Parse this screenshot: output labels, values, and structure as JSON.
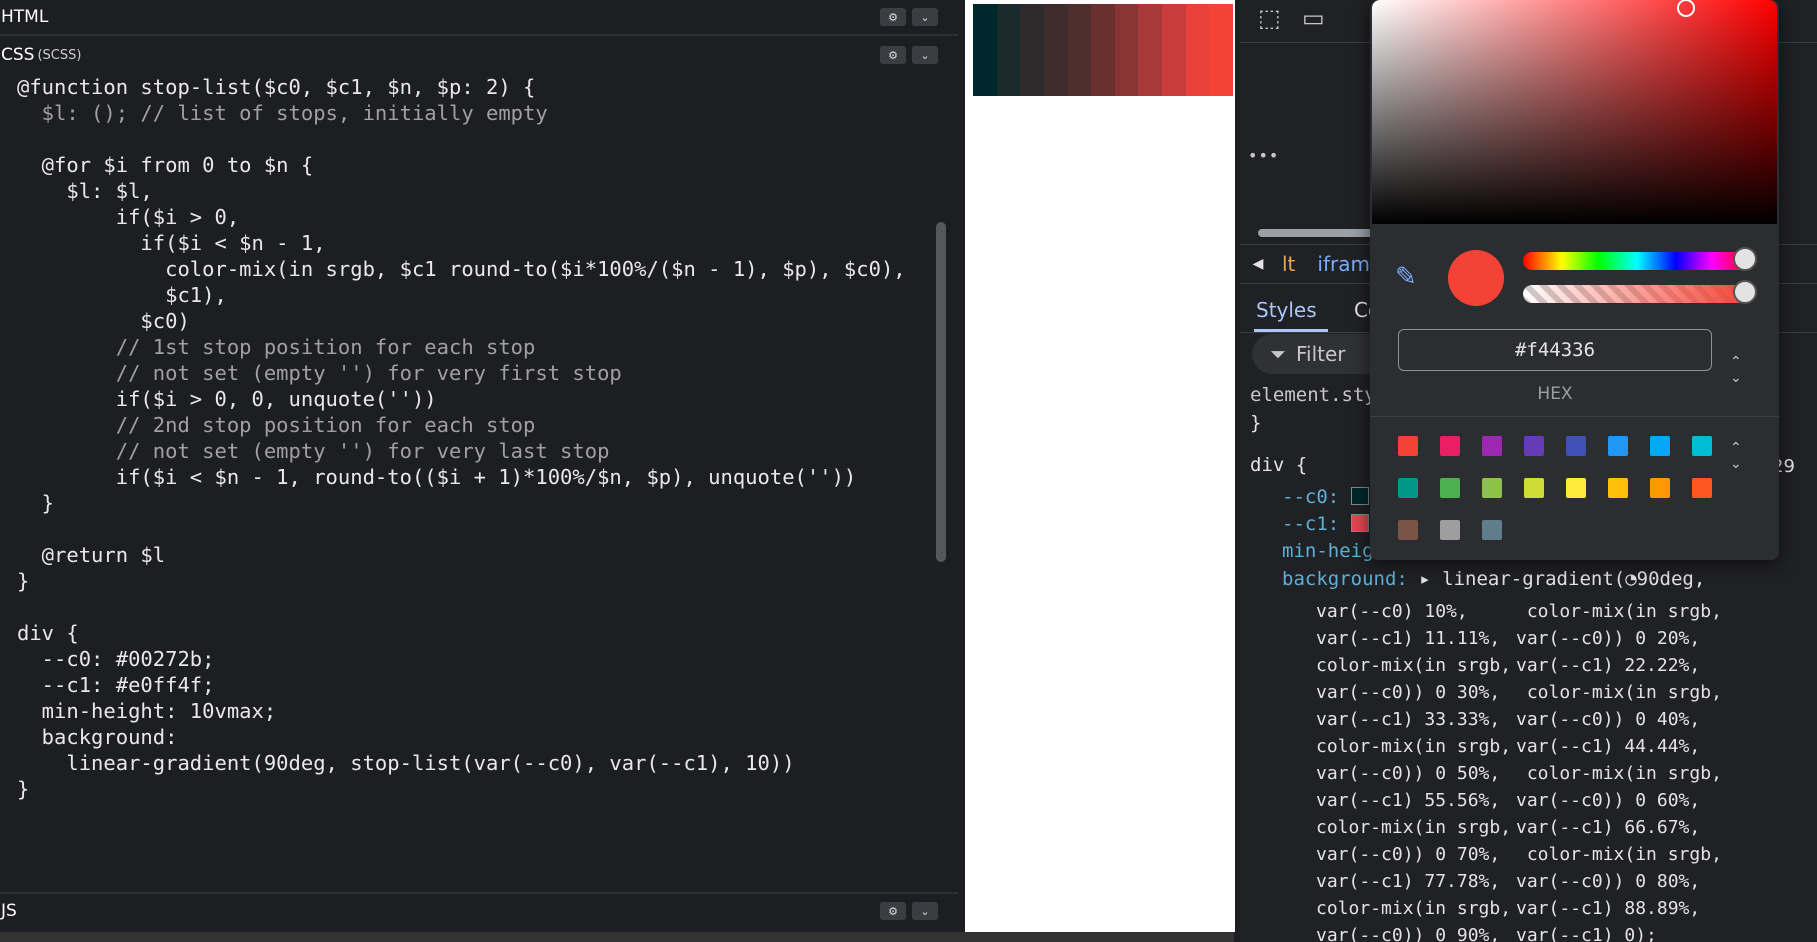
{
  "editor": {
    "html_title": "HTML",
    "css_title": "CSS",
    "css_sub": "(SCSS)",
    "js_title": "JS",
    "settings_icon": "gear-icon",
    "collapse_icon": "chevron-down-icon",
    "code_lines": [
      "@function stop-list($c0, $c1, $n, $p: 2) {",
      "  $l: (); // list of stops, initially empty",
      "",
      "  @for $i from 0 to $n {",
      "    $l: $l,",
      "        if($i > 0,",
      "          if($i < $n - 1,",
      "            color-mix(in srgb, $c1 round-to($i*100%/($n - 1), $p), $c0),",
      "            $c1),",
      "          $c0)",
      "        // 1st stop position for each stop",
      "        // not set (empty '') for very first stop",
      "        if($i > 0, 0, unquote(''))",
      "        // 2nd stop position for each stop",
      "        // not set (empty '') for very last stop",
      "        if($i < $n - 1, round-to(($i + 1)*100%/$n, $p), unquote(''))",
      "  }",
      "",
      "  @return $l",
      "}",
      "",
      "div {",
      "  --c0: #00272b;",
      "  --c1: #e0ff4f;",
      "  min-height: 10vmax;",
      "  background:",
      "    linear-gradient(90deg, stop-list(var(--c0), var(--c1), 10))",
      "}"
    ]
  },
  "preview": {
    "stripe_colors": [
      "#00272b",
      "#1b2a2d",
      "#2f2b2c",
      "#3f2c2d",
      "#502e2e",
      "#6a3030",
      "#8a3535",
      "#a93939",
      "#c83c3c",
      "#e8413a",
      "#f44336"
    ]
  },
  "devtools": {
    "breadcrumb_left": "lt",
    "breadcrumb_iframe": "iframe",
    "tab_styles": "Styles",
    "tab_computed": "Co",
    "filter_label": "Filter",
    "element_style": "element.sty",
    "close_brace": "}",
    "div_selector": "div {",
    "line_number": "29",
    "prop_c0": "--c0:",
    "prop_c1": "--c1:",
    "prop_minheight": "min-heig",
    "prop_background": "background:",
    "background_value": "linear-gradient(",
    "angle": "90deg,",
    "gradient_lines": [
      "var(--c0) 10%,",
      " color-mix(in srgb,",
      "var(--c1) 11.11%,",
      "var(--c0)) 0 20%,",
      "color-mix(in srgb,",
      "var(--c1) 22.22%,",
      "var(--c0)) 0 30%,",
      " color-mix(in srgb,",
      "var(--c1) 33.33%,",
      "var(--c0)) 0 40%,",
      "color-mix(in srgb,",
      "var(--c1) 44.44%,",
      "var(--c0)) 0 50%,",
      " color-mix(in srgb,",
      "var(--c1) 55.56%,",
      "var(--c0)) 0 60%,",
      "color-mix(in srgb,",
      "var(--c1) 66.67%,",
      "var(--c0)) 0 70%,",
      " color-mix(in srgb,",
      "var(--c1) 77.78%,",
      "var(--c0)) 0 80%,",
      "color-mix(in srgb,",
      "var(--c1) 88.89%,",
      "var(--c0)) 0 90%,",
      "var(--c1) 0);"
    ]
  },
  "color_picker": {
    "hex_value": "#f44336",
    "hex_label": "HEX",
    "current_color": "#f44336",
    "palette": [
      "#f44336",
      "#e91e63",
      "#9c27b0",
      "#673ab7",
      "#3f51b5",
      "#2196f3",
      "#03a9f4",
      "#00bcd4",
      "#009688",
      "#4caf50",
      "#8bc34a",
      "#cddc39",
      "#ffeb3b",
      "#ffc107",
      "#ff9800",
      "#ff5722",
      "#795548",
      "#9e9e9e",
      "#607d8b"
    ]
  }
}
